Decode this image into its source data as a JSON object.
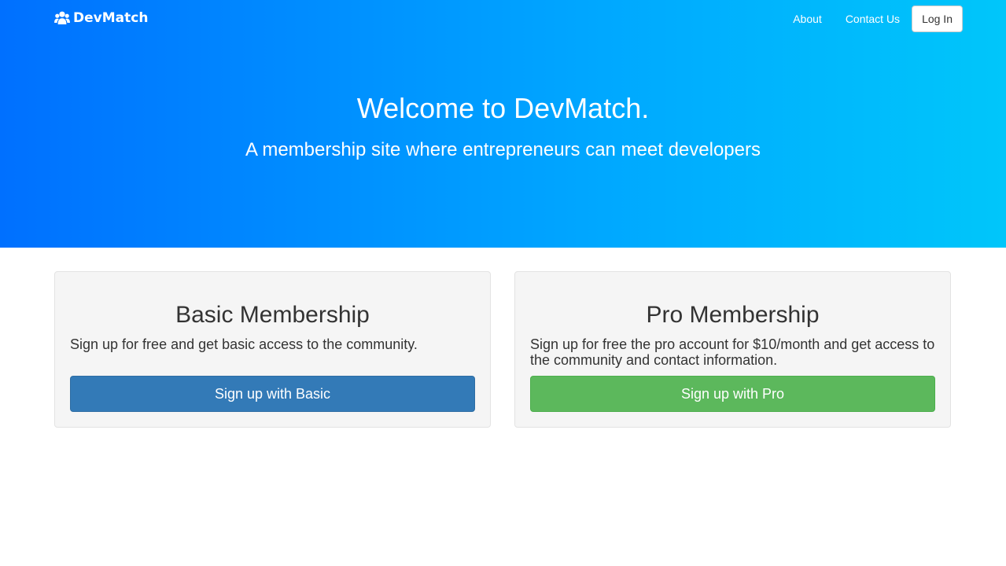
{
  "nav": {
    "brand": "DevMatch",
    "brand_icon": "users-icon",
    "links": [
      "About",
      "Contact Us"
    ],
    "login_label": "Log In"
  },
  "hero": {
    "title": "Welcome to DevMatch.",
    "subtitle": "A membership site where entrepreneurs can meet developers"
  },
  "plans": [
    {
      "title": "Basic Membership",
      "description": "Sign up for free and get basic access to the community.",
      "button": "Sign up with Basic"
    },
    {
      "title": "Pro Membership",
      "description": "Sign up for free the pro account for $10/month and get access to the community and contact information.",
      "button": "Sign up with Pro"
    }
  ],
  "colors": {
    "hero_gradient_start": "#0070ff",
    "hero_gradient_end": "#00c6fa",
    "basic_button": "#337ab7",
    "pro_button": "#5cb85c",
    "card_background": "#f5f5f5"
  }
}
